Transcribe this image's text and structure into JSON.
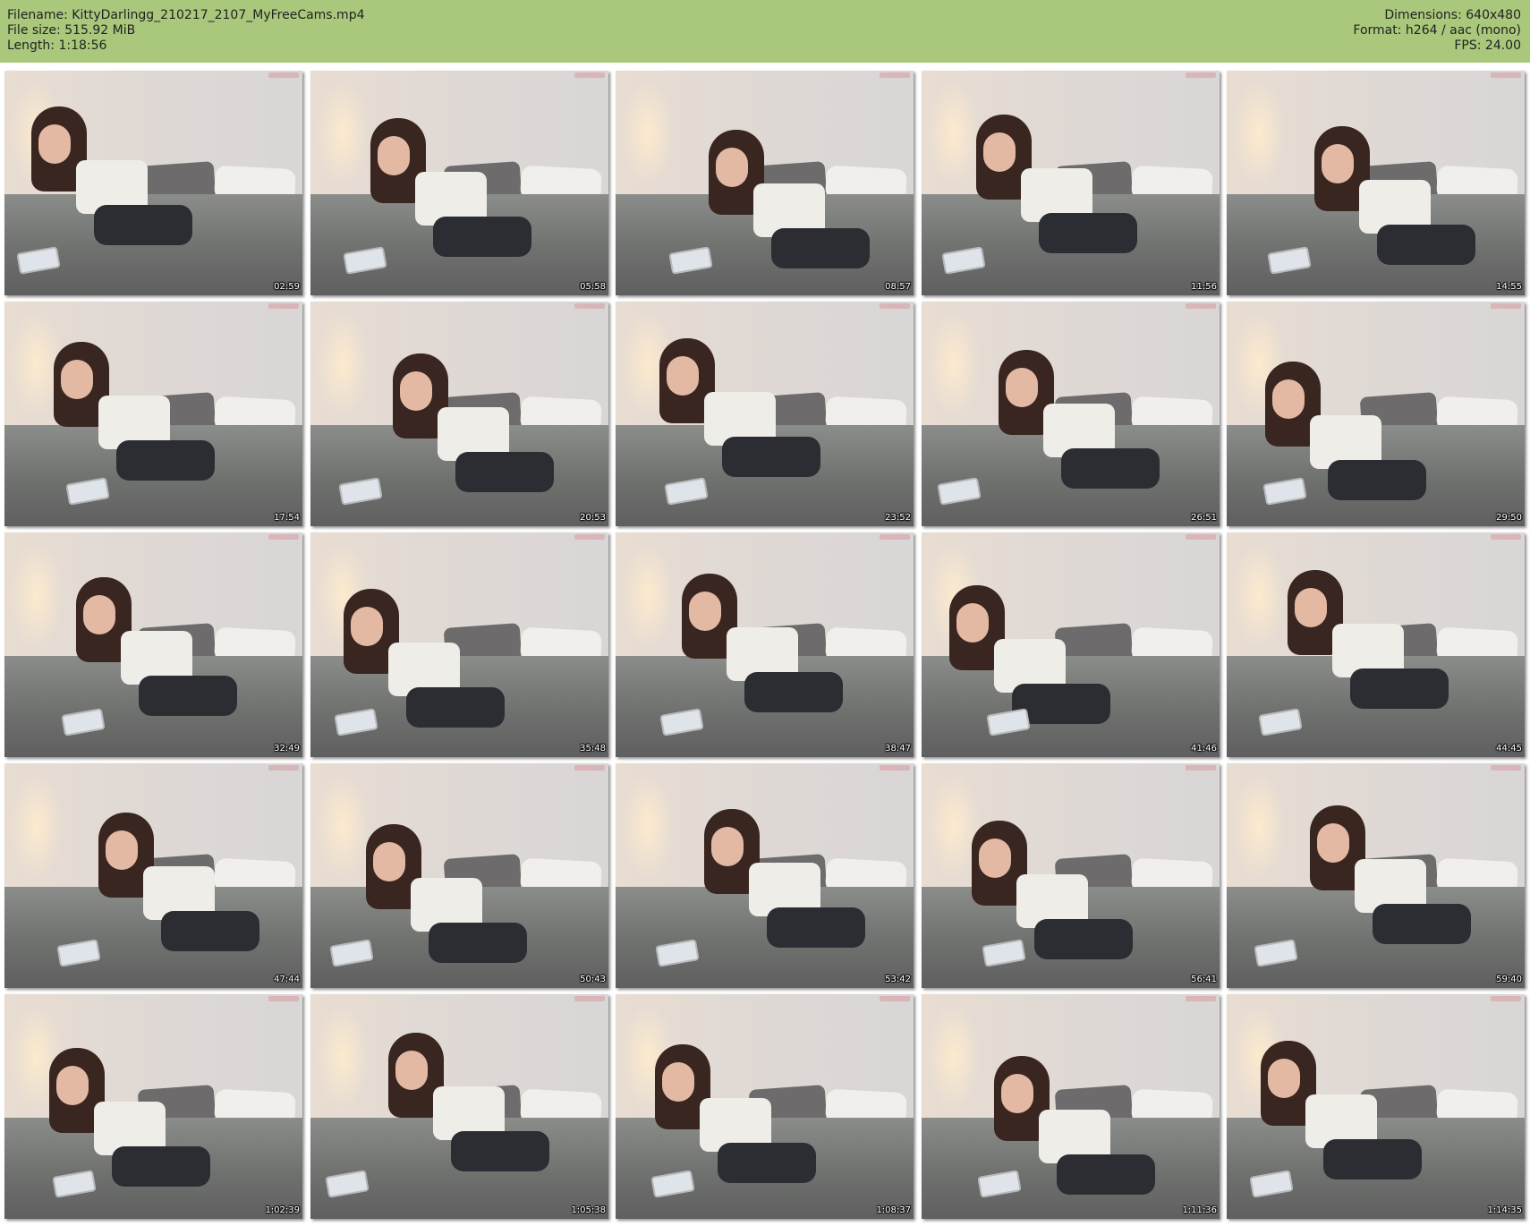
{
  "file_info": {
    "filename": "Filename: KittyDarlingg_210217_2107_MyFreeCams.mp4",
    "file_size": "File size: 515.92 MiB",
    "length": "Length: 1:18:56",
    "dimensions": "Dimensions: 640x480",
    "format": "Format: h264 / aac (mono)",
    "fps": "FPS: 24.00"
  },
  "colors": {
    "header_background": "#a9c87b",
    "page_background": "#ffffff",
    "timestamp_text": "#ffffff"
  },
  "thumbnails": [
    {
      "timestamp": "02:59"
    },
    {
      "timestamp": "05:58"
    },
    {
      "timestamp": "08:57"
    },
    {
      "timestamp": "11:56"
    },
    {
      "timestamp": "14:55"
    },
    {
      "timestamp": "17:54"
    },
    {
      "timestamp": "20:53"
    },
    {
      "timestamp": "23:52"
    },
    {
      "timestamp": "26:51"
    },
    {
      "timestamp": "29:50"
    },
    {
      "timestamp": "32:49"
    },
    {
      "timestamp": "35:48"
    },
    {
      "timestamp": "38:47"
    },
    {
      "timestamp": "41:46"
    },
    {
      "timestamp": "44:45"
    },
    {
      "timestamp": "47:44"
    },
    {
      "timestamp": "50:43"
    },
    {
      "timestamp": "53:42"
    },
    {
      "timestamp": "56:41"
    },
    {
      "timestamp": "59:40"
    },
    {
      "timestamp": "1:02:39"
    },
    {
      "timestamp": "1:05:38"
    },
    {
      "timestamp": "1:08:37"
    },
    {
      "timestamp": "1:11:36"
    },
    {
      "timestamp": "1:14:35"
    }
  ]
}
